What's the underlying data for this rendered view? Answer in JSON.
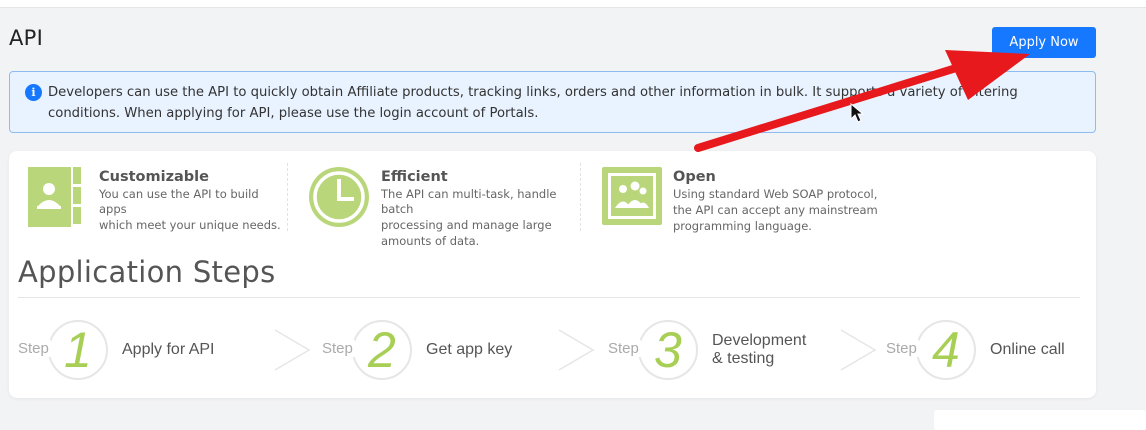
{
  "page": {
    "title": "API",
    "apply_label": "Apply Now"
  },
  "notice": {
    "text": "Developers can use the API to quickly obtain Affiliate products, tracking links, orders and other information in bulk. It supports a variety of filtering conditions. When applying for API, please use the login account of Portals."
  },
  "features": [
    {
      "title": "Customizable",
      "desc": [
        "You can use the API to build apps",
        "which meet your unique needs."
      ],
      "icon": "contact-book-icon"
    },
    {
      "title": "Efficient",
      "desc": [
        "The API can multi-task, handle batch",
        "processing and manage large",
        "amounts of data."
      ],
      "icon": "clock-icon"
    },
    {
      "title": "Open",
      "desc": [
        "Using standard Web SOAP protocol,",
        "the API can accept any mainstream",
        "programming language."
      ],
      "icon": "users-window-icon"
    }
  ],
  "steps_title": "Application Steps",
  "steps": [
    {
      "label": "Step",
      "num": "1",
      "text": [
        "Apply for API"
      ]
    },
    {
      "label": "Step",
      "num": "2",
      "text": [
        "Get app key"
      ]
    },
    {
      "label": "Step",
      "num": "3",
      "text": [
        "Development",
        "& testing"
      ]
    },
    {
      "label": "Step",
      "num": "4",
      "text": [
        "Online call"
      ]
    }
  ],
  "colors": {
    "primary": "#1677ff",
    "notice_bg": "#e8f3ff",
    "accent_green": "#a8cf55",
    "annotation_red": "#e8191c"
  }
}
